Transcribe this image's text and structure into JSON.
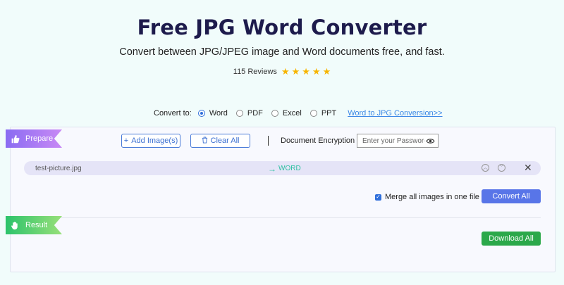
{
  "header": {
    "title": "Free JPG Word Converter",
    "subtitle": "Convert between JPG/JPEG image and Word documents free, and fast.",
    "reviews": "115 Reviews",
    "rating_stars": 5
  },
  "convert": {
    "label": "Convert to:",
    "options": [
      "Word",
      "PDF",
      "Excel",
      "PPT"
    ],
    "selected": "Word",
    "link": "Word to JPG Conversion>>"
  },
  "prepare": {
    "ribbon_label": "Prepare",
    "add_button": "Add Image(s)",
    "clear_button": "Clear All",
    "encryption_label": "Document Encryption",
    "password_placeholder": "Enter your Password."
  },
  "file": {
    "name": "test-picture.jpg",
    "target": "WORD"
  },
  "actions": {
    "merge_label": "Merge all images in one file",
    "merge_checked": true,
    "convert_button": "Convert All"
  },
  "result": {
    "ribbon_label": "Result",
    "download_button": "Download All"
  },
  "colors": {
    "background": "#f1fcfb",
    "title": "#1d1b4c",
    "accent_blue": "#5875e8",
    "download_green": "#2ba84a",
    "star": "#f7b500",
    "prepare_ribbon": "#8a6cf2",
    "result_ribbon": "#2cc36b"
  }
}
